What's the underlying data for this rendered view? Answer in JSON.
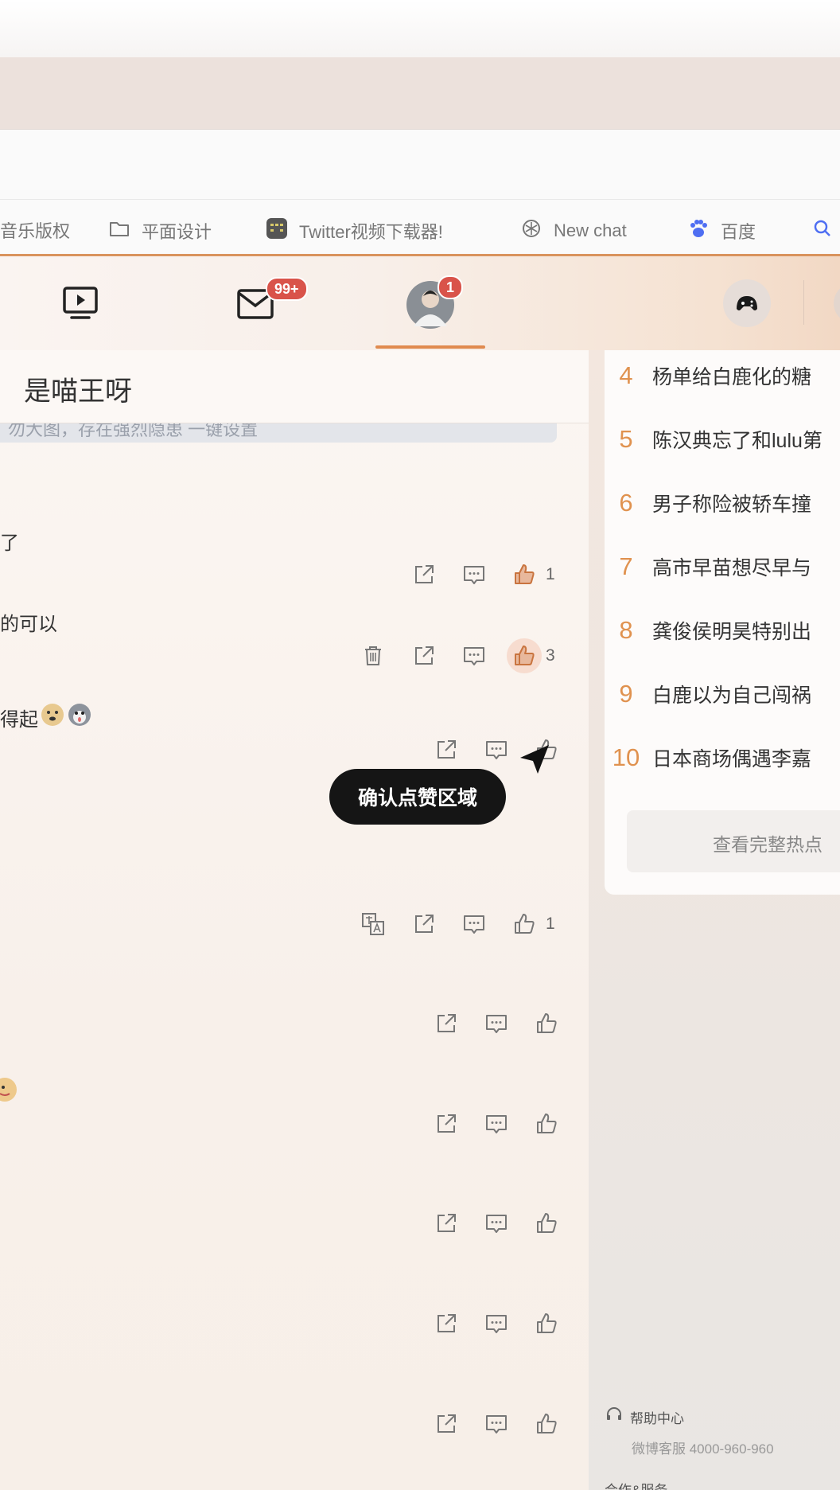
{
  "bookmarks": [
    {
      "label": "音乐版权",
      "icon": "none"
    },
    {
      "label": "平面设计",
      "icon": "folder-icon"
    },
    {
      "label": "Twitter视频下载器!",
      "icon": "downloader-app-icon"
    },
    {
      "label": "New chat",
      "icon": "openai-icon"
    },
    {
      "label": "百度",
      "icon": "baidu-paw-icon"
    }
  ],
  "nav": {
    "mail_badge": "99+",
    "profile_badge": "1"
  },
  "post": {
    "title": "是喵王呀",
    "notice_fragment": "勿大图，存在强烈隐患 一键设置"
  },
  "comments": [
    {
      "fragment": "了",
      "like_count": "1"
    },
    {
      "fragment": "的可以",
      "like_count": "3"
    },
    {
      "fragment": "得起",
      "like_count": ""
    },
    {
      "fragment": "",
      "like_count": "1"
    },
    {
      "fragment": "",
      "like_count": ""
    },
    {
      "fragment": "",
      "like_count": ""
    },
    {
      "fragment": "",
      "like_count": ""
    },
    {
      "fragment": "",
      "like_count": ""
    },
    {
      "fragment": "",
      "like_count": ""
    }
  ],
  "tooltip": "确认点赞区域",
  "hot_list": {
    "items": [
      {
        "rank": "4",
        "text": "杨单给白鹿化的糖"
      },
      {
        "rank": "5",
        "text": "陈汉典忘了和lulu第"
      },
      {
        "rank": "6",
        "text": "男子称险被轿车撞"
      },
      {
        "rank": "7",
        "text": "高市早苗想尽早与"
      },
      {
        "rank": "8",
        "text": "龚俊侯明昊特别出"
      },
      {
        "rank": "9",
        "text": "白鹿以为自己闯祸"
      },
      {
        "rank": "10",
        "text": "日本商场偶遇李嘉"
      }
    ],
    "more_label": "查看完整热点"
  },
  "footer": {
    "help_label": "帮助中心",
    "service_label": "微博客服 4000-960-960",
    "cooperation_label": "合作&服务"
  },
  "colors": {
    "accent": "#e0924f",
    "badge": "#d9534a",
    "tooltip_bg": "#151515"
  }
}
